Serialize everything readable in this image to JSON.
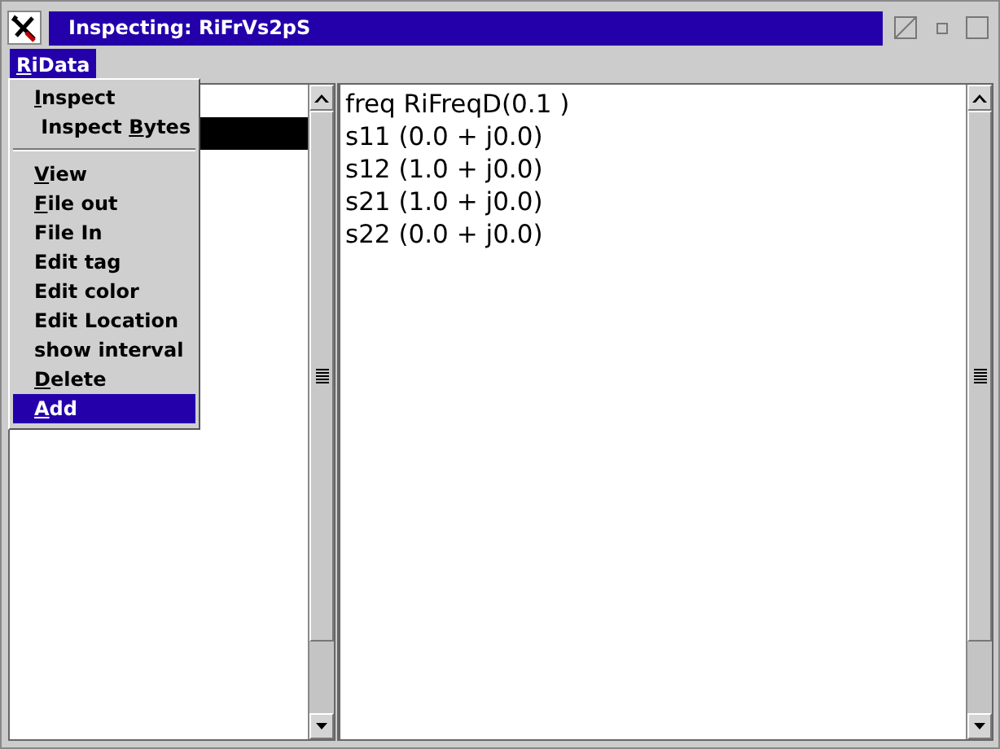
{
  "window": {
    "title": "Inspecting: RiFrVs2pS"
  },
  "menubar": [
    {
      "key": "R",
      "post": "iData",
      "selected": true
    }
  ],
  "menu": {
    "groups": [
      [
        {
          "key": "I",
          "post": "nspect",
          "selected": false
        },
        {
          "pre": " Inspect ",
          "key": "B",
          "post": "ytes",
          "selected": false
        }
      ],
      [
        {
          "key": "V",
          "post": "iew",
          "selected": false
        },
        {
          "key": "F",
          "post": "ile out",
          "selected": false
        },
        {
          "pre": "File In",
          "selected": false
        },
        {
          "pre": "Edit tag",
          "selected": false
        },
        {
          "pre": "Edit color",
          "selected": false
        },
        {
          "pre": "Edit Location",
          "selected": false
        },
        {
          "pre": "show interval",
          "selected": false
        },
        {
          "key": "D",
          "post": "elete",
          "selected": false
        },
        {
          "key": "A",
          "post": "dd",
          "selected": true
        }
      ]
    ]
  },
  "left_list": {
    "rows": [
      {
        "selected": false
      },
      {
        "selected": true
      }
    ]
  },
  "text_pane": {
    "lines": [
      "freq RiFreqD(0.1 )",
      "s11 (0.0 + j0.0)",
      "s12 (1.0 + j0.0)",
      "s21 (1.0 + j0.0)",
      "s22 (0.0 + j0.0)"
    ]
  }
}
